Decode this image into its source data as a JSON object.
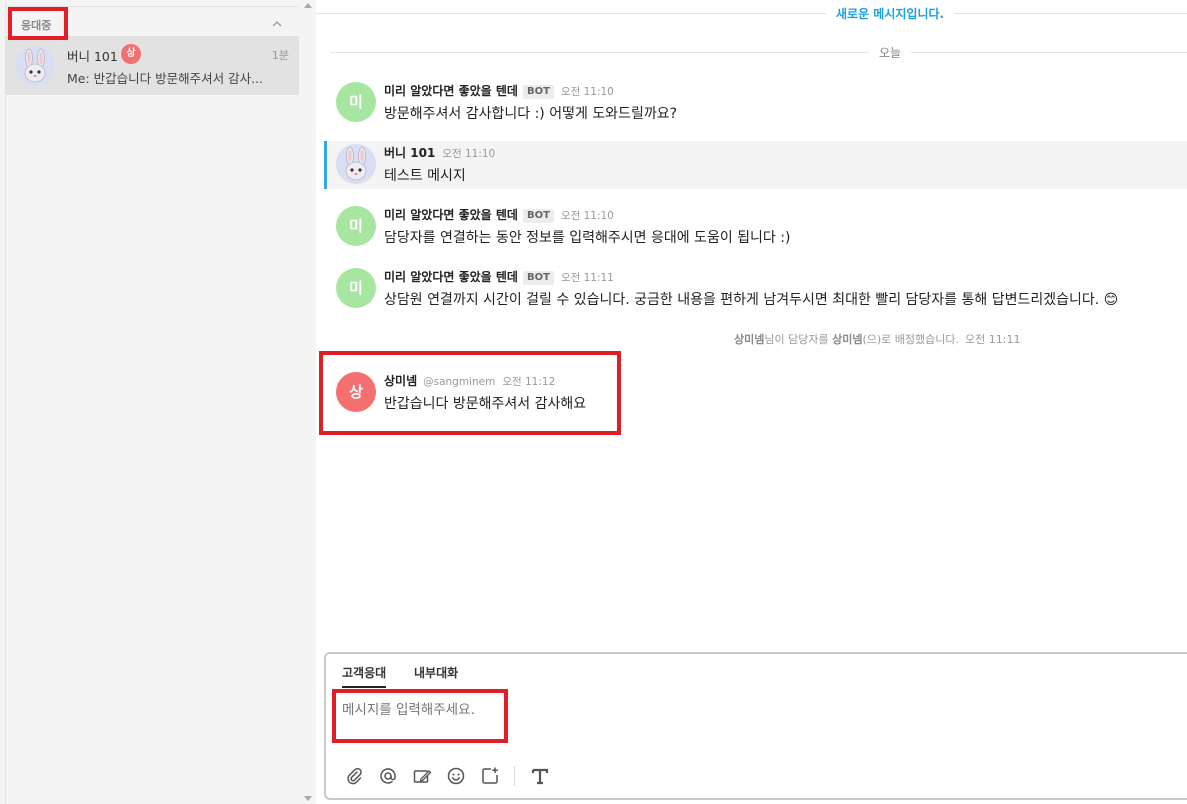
{
  "sidebar": {
    "section_title": "응대중",
    "chat_item": {
      "name": "버니 101",
      "badge": "상",
      "time": "1분",
      "preview": "Me: 반갑습니다 방문해주셔서 감사..."
    }
  },
  "main": {
    "new_messages_label": "새로운 메시지입니다.",
    "today_label": "오늘",
    "messages": [
      {
        "sender": "미리 알았다면 좋았을 텐데",
        "tag": "BOT",
        "time": "오전 11:10",
        "avatar_text": "미",
        "text": "방문해주셔서 감사합니다 :) 어떻게 도와드릴까요?"
      },
      {
        "sender": "버니 101",
        "time": "오전 11:10",
        "text": "테스트 메시지"
      },
      {
        "sender": "미리 알았다면 좋았을 텐데",
        "tag": "BOT",
        "time": "오전 11:10",
        "avatar_text": "미",
        "text": "담당자를 연결하는 동안 정보를 입력해주시면 응대에 도움이 됩니다 :)"
      },
      {
        "sender": "미리 알았다면 좋았을 텐데",
        "tag": "BOT",
        "time": "오전 11:11",
        "avatar_text": "미",
        "text": "상담원 연결까지 시간이 걸릴 수 있습니다. 궁금한 내용을 편하게 남겨두시면 최대한 빨리 담당자를 통해 답변드리겠습니다. 😊"
      },
      {
        "sender": "상미넴",
        "handle": "@sangminem",
        "time": "오전 11:12",
        "avatar_text": "상",
        "text": "반갑습니다 방문해주셔서 감사해요"
      }
    ],
    "system_note": {
      "name1": "상미넴",
      "part1": "님이 담당자를 ",
      "name2": "상미넴",
      "part2": "(으)로 배정했습니다.",
      "time": "오전 11:11"
    }
  },
  "composer": {
    "tab_customer": "고객응대",
    "tab_internal": "내부대화",
    "placeholder": "메시지를 입력해주세요."
  },
  "colors": {
    "accent": "#1ba0e0",
    "bot_avatar": "#a6e6a0",
    "agent_avatar": "#f46f6f",
    "highlight_box": "#e01e28"
  },
  "icons": [
    "paperclip-icon",
    "at-icon",
    "edit-icon",
    "emoji-icon",
    "add-icon",
    "text-format-icon"
  ]
}
